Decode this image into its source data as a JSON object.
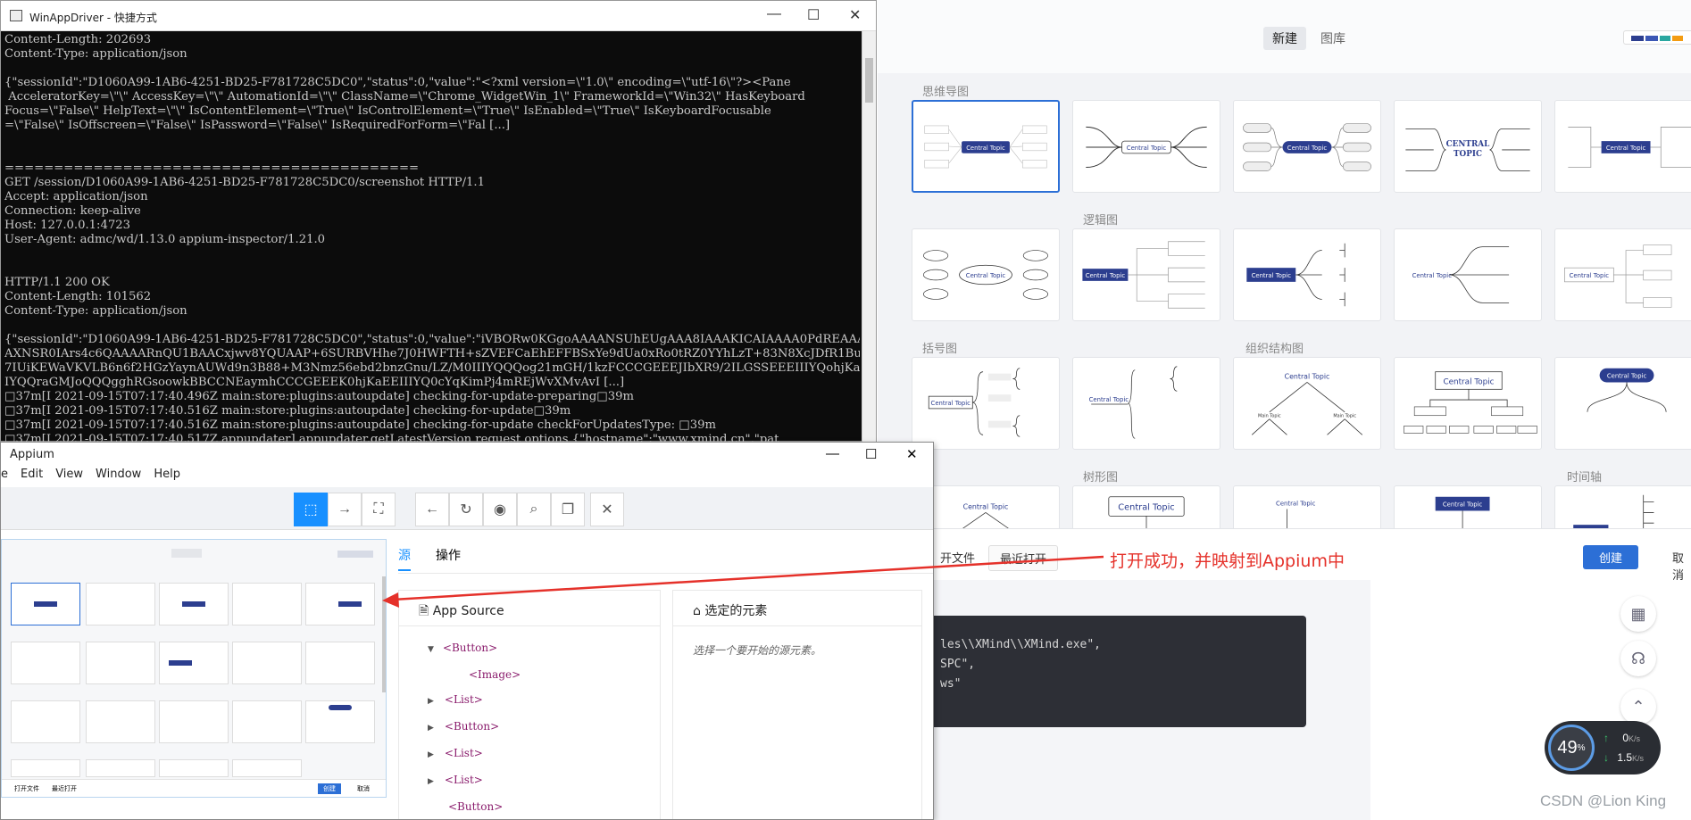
{
  "xmind": {
    "tabs": [
      "新建",
      "图库"
    ],
    "categories": {
      "mindmap": "思维导图",
      "logic": "逻辑图",
      "brace": "括号图",
      "org": "组织结构图",
      "tree": "树形图",
      "timeline": "时间轴"
    },
    "thumb_central": "Central Topic",
    "thumb_central_caps": "CENTRAL TOPIC",
    "thumb_main": "Main Topic",
    "footer": {
      "open_file": "开文件",
      "recent": "最近打开",
      "create": "创建",
      "cancel": "取消"
    },
    "code_lines": [
      "les\\\\XMind\\\\XMind.exe\",",
      "SPC\",",
      "ws\""
    ],
    "net": {
      "percent": "49",
      "percent_unit": "%",
      "up": "0",
      "up_unit": "K/s",
      "down": "1.5",
      "down_unit": "K/s"
    }
  },
  "console": {
    "title": "WinAppDriver - 快捷方式",
    "lines": [
      "Content-Length: 202693",
      "Content-Type: application/json",
      "",
      "{\"sessionId\":\"D1060A99-1AB6-4251-BD25-F781728C5DC0\",\"status\":0,\"value\":\"<?xml version=\\\"1.0\\\" encoding=\\\"utf-16\\\"?><Pane",
      " AcceleratorKey=\\\"\\\" AccessKey=\\\"\\\" AutomationId=\\\"\\\" ClassName=\\\"Chrome_WidgetWin_1\\\" FrameworkId=\\\"Win32\\\" HasKeyboard",
      "Focus=\\\"False\\\" HelpText=\\\"\\\" IsContentElement=\\\"True\\\" IsControlElement=\\\"True\\\" IsEnabled=\\\"True\\\" IsKeyboardFocusable",
      "=\\\"False\\\" IsOffscreen=\\\"False\\\" IsPassword=\\\"False\\\" IsRequiredForForm=\\\"Fal [...]",
      "",
      "",
      "==========================================",
      "GET /session/D1060A99-1AB6-4251-BD25-F781728C5DC0/screenshot HTTP/1.1",
      "Accept: application/json",
      "Connection: keep-alive",
      "Host: 127.0.0.1:4723",
      "User-Agent: admc/wd/1.13.0 appium-inspector/1.21.0",
      "",
      "",
      "HTTP/1.1 200 OK",
      "Content-Length: 101562",
      "Content-Type: application/json",
      "",
      "{\"sessionId\":\"D1060A99-1AB6-4251-BD25-F781728C5DC0\",\"status\":0,\"value\":\"iVBORw0KGgoAAAANSUhEUgAAA8IAAAKICAIAAAA0PdREAAAA",
      "AXNSR0IArs4c6QAAAARnQU1BAACxjwv8YQUAAP+6SURBVHhe7J0HWFTH+sZVEFCaEhEFFBSxYe9dUa0xRo0tRZ0YYhLzT+83N8XcJDfR1BuTmGZMoknU2LA3",
      "7IUiKEWaVKVLB6n6f2HGzYaynAUWd9n3B88+M3Nmz56ebd2bnzGnu/LZ/M0IIIYQQQog21mGH/1kzFCCCGEEEJIbXR9/2ILGSSEEEIIIYQohjKaEEII",
      "IYQQraGMJoQQQgghRGsoowkBBCCNEaymhCCCGEEEK0hjKaEEIIIYQ0cYqKimPj4mREjWvXMvAvI [...]",
      "□37m[I 2021-09-15T07:17:40.496Z main:store:plugins:autoupdate] checking-for-update-preparing□39m",
      "□37m[I 2021-09-15T07:17:40.516Z main:store:plugins:autoupdate] checking-for-update□39m",
      "□37m[I 2021-09-15T07:17:40.516Z main:store:plugins:autoupdate] checking-for-update checkForUpdatesType: □39m",
      "□37m[I 2021-09-15T07:17:40.517Z appupdater] appupdater.getLatestVersion request options {\"hostname\":\"www.xmind.cn\",\"pat"
    ]
  },
  "appium": {
    "title": "Appium",
    "menu": [
      "e",
      "Edit",
      "View",
      "Window",
      "Help"
    ],
    "tabs": [
      "源",
      "操作"
    ],
    "source_title": "App Source",
    "selected_title": "选定的元素",
    "selected_hint": "选择一个要开始的源元素。",
    "tree": [
      "<Button>",
      "<Image>",
      "<List>",
      "<Button>",
      "<List>",
      "<List>",
      "<Button>"
    ],
    "shot_footer": {
      "open": "打开文件",
      "recent": "最近打开",
      "create": "创建",
      "cancel": "取消"
    }
  },
  "annotation": "打开成功，并映射到Appium中",
  "watermark": "CSDN @Lion King"
}
